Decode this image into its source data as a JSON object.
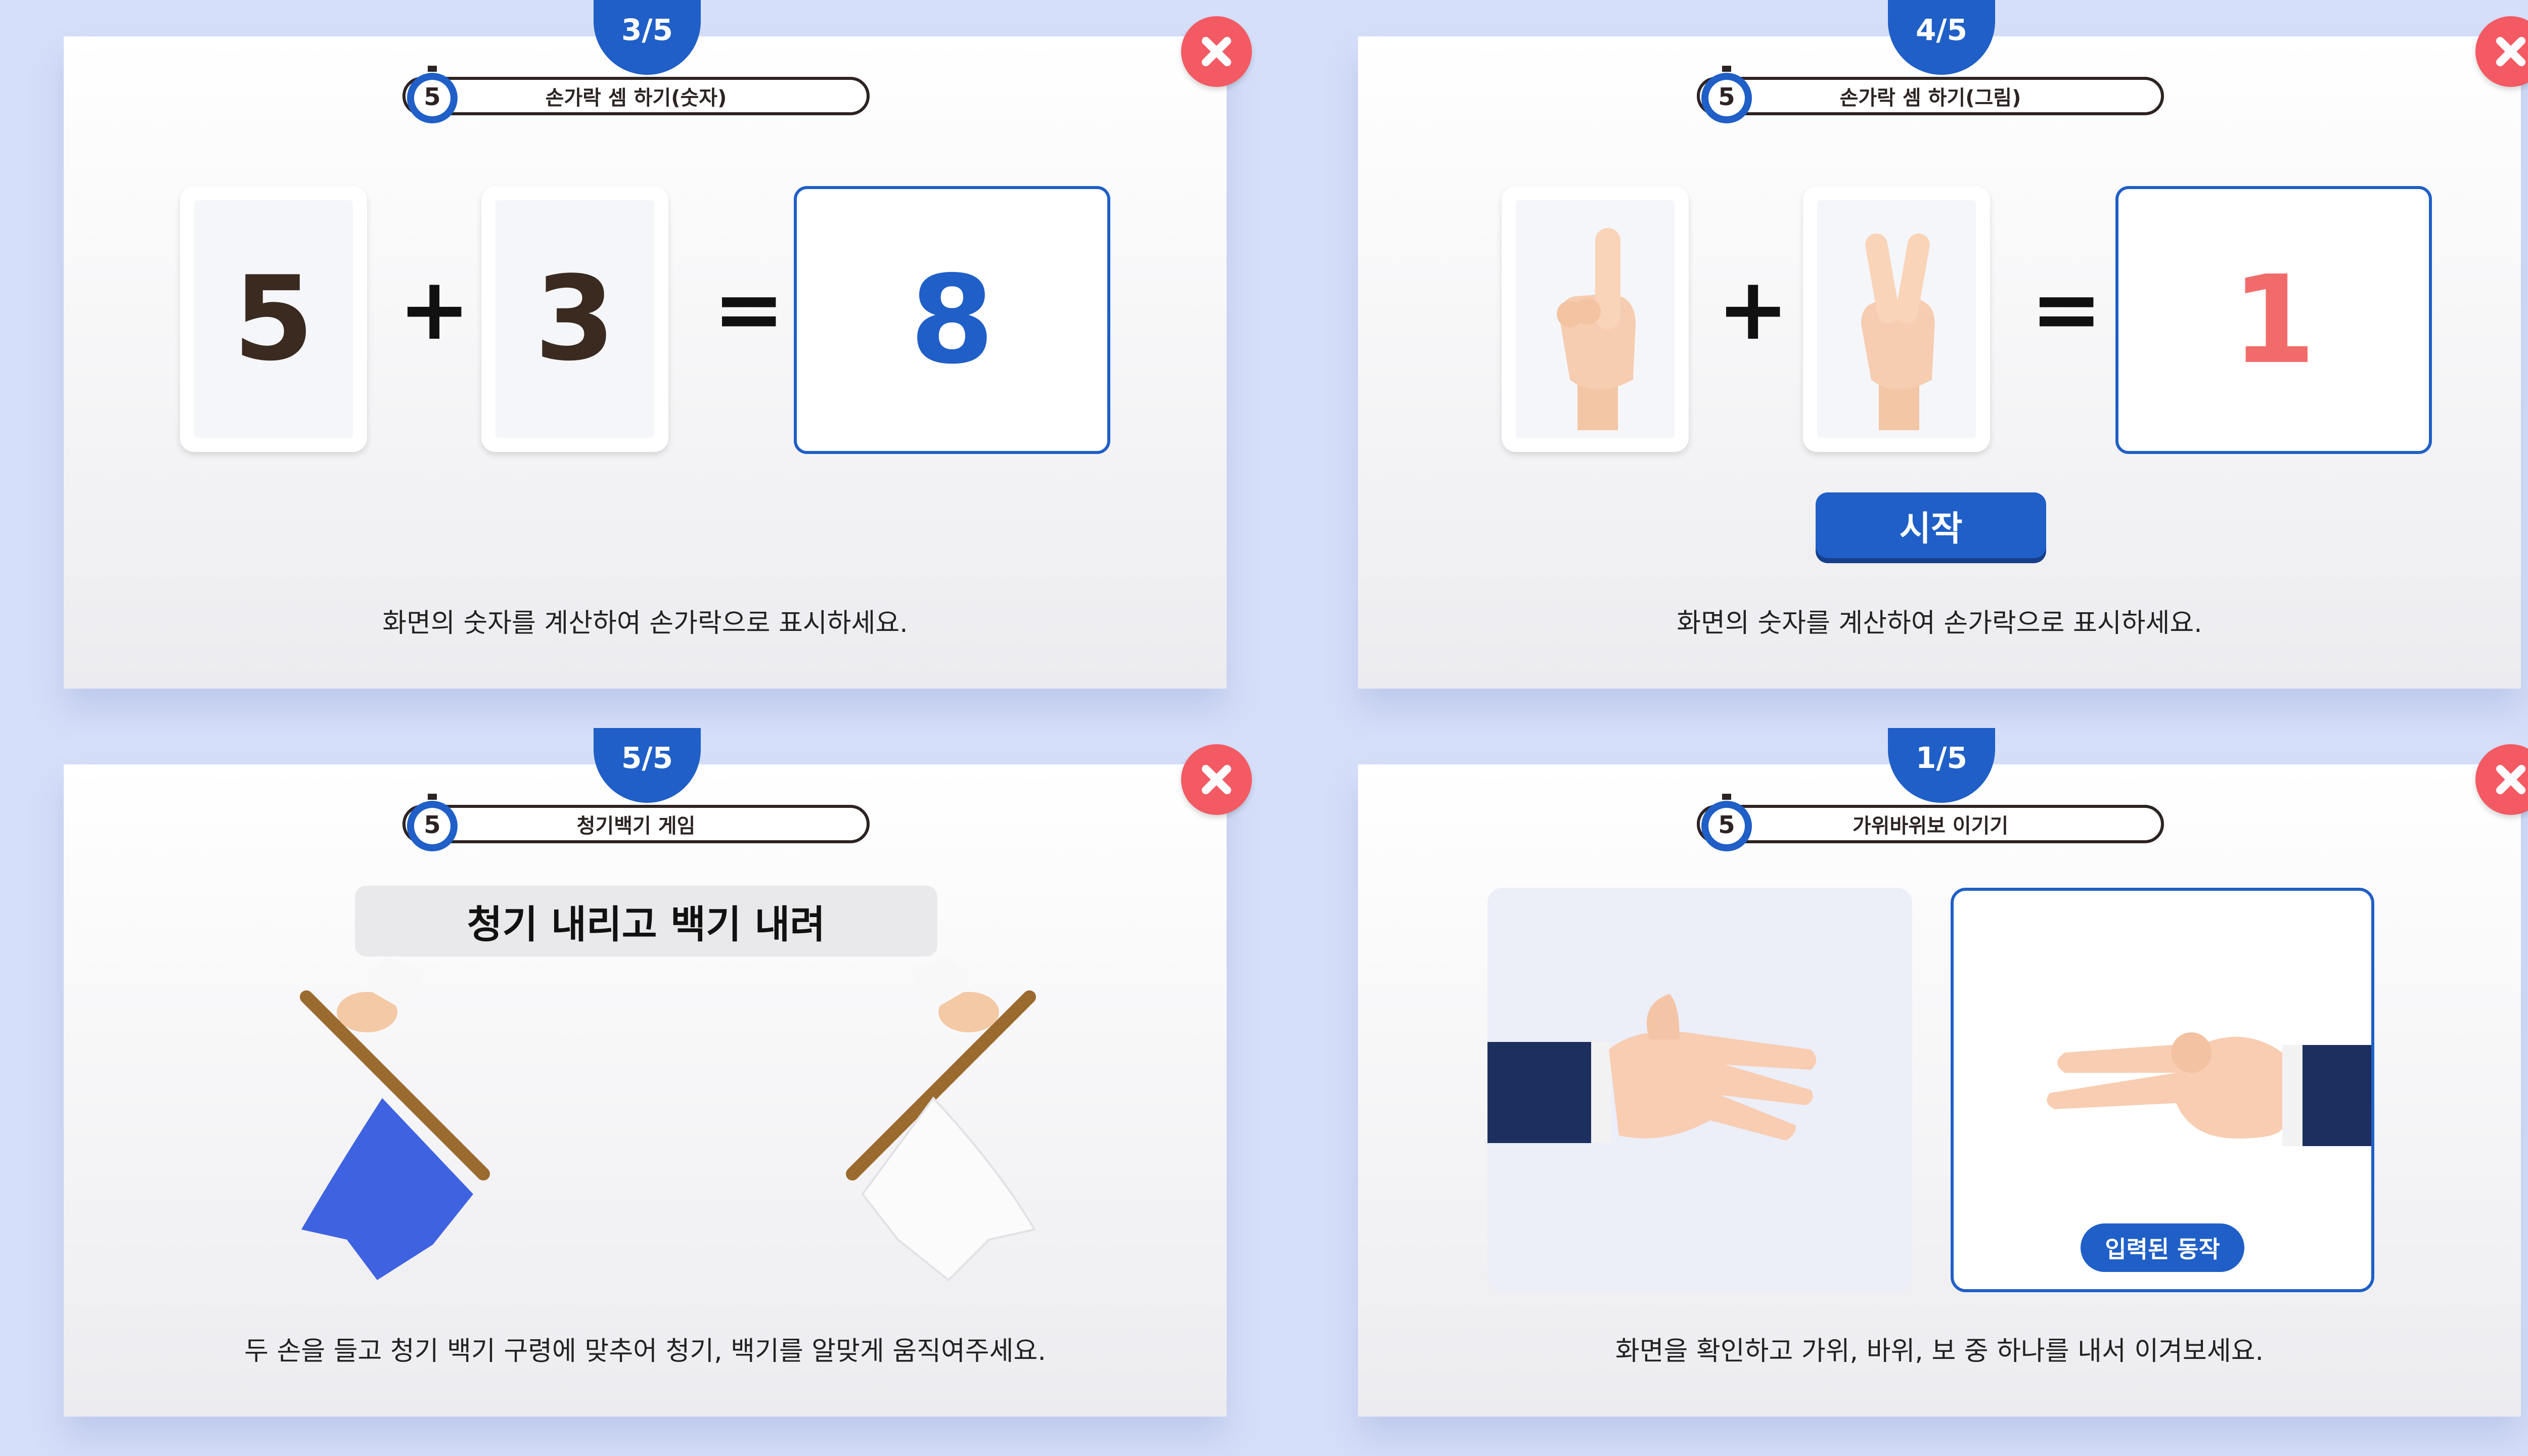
{
  "colors": {
    "background": "#d6dff9",
    "accent_blue": "#1f5fc7",
    "close_red": "#f35a63",
    "answer_blue": "#1f5fc7",
    "answer_red": "#f26b6b",
    "digit_brown": "#3a2a1f"
  },
  "panels": [
    {
      "id": "finger-count-numbers",
      "progress": "3/5",
      "timer": "5",
      "title": "손가락 셈 하기(숫자)",
      "operand_a": "5",
      "operator": "+",
      "operand_b": "3",
      "equals": "=",
      "answer": "8",
      "instruction": "화면의 숫자를 계산하여 손가락으로 표시하세요."
    },
    {
      "id": "finger-count-pictures",
      "progress": "4/5",
      "timer": "5",
      "title": "손가락 셈 하기(그림)",
      "operand_a_icon": "one-finger-hand-icon",
      "operator": "+",
      "operand_b_icon": "two-finger-hand-icon",
      "equals": "=",
      "answer": "1",
      "start_button": "시작",
      "instruction": "화면의 숫자를 계산하여 손가락으로 표시하세요."
    },
    {
      "id": "flag-game",
      "progress": "5/5",
      "timer": "5",
      "title": "청기백기 게임",
      "command": "청기 내리고 백기 내려",
      "left_flag_icon": "blue-flag-icon",
      "right_flag_icon": "white-flag-icon",
      "instruction": "두 손을 들고 청기 백기 구령에 맞추어 청기, 백기를 알맞게 움직여주세요."
    },
    {
      "id": "rock-paper-scissors",
      "progress": "1/5",
      "timer": "5",
      "title": "가위바위보 이기기",
      "left_hand_icon": "paper-hand-icon",
      "right_hand_icon": "scissors-hand-icon",
      "input_badge": "입력된 동작",
      "instruction": "화면을 확인하고 가위, 바위, 보 중 하나를 내서 이겨보세요."
    }
  ]
}
